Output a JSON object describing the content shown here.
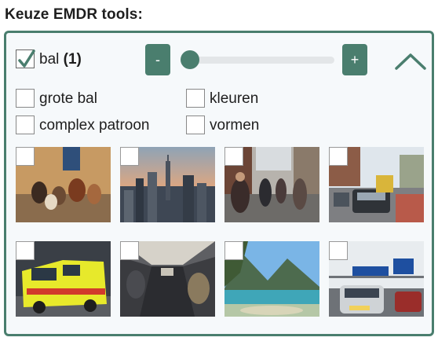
{
  "header": {
    "title": "Keuze EMDR tools:"
  },
  "main_tool": {
    "name": "bal",
    "count": "(1)",
    "checked": true
  },
  "speed": {
    "minus_label": "-",
    "plus_label": "+",
    "level": 0.0
  },
  "options": [
    {
      "label": "grote bal",
      "checked": false
    },
    {
      "label": "kleuren",
      "checked": false
    },
    {
      "label": "complex patroon",
      "checked": false
    },
    {
      "label": "vormen",
      "checked": false
    }
  ],
  "images": [
    {
      "name": "dogs-on-leash-image"
    },
    {
      "name": "city-skyline-sunset-image"
    },
    {
      "name": "cyclists-street-image"
    },
    {
      "name": "traffic-jam-city-image"
    },
    {
      "name": "ambulance-image"
    },
    {
      "name": "airplane-aisle-image"
    },
    {
      "name": "mountain-lake-image"
    },
    {
      "name": "highway-traffic-image"
    }
  ],
  "colors": {
    "accent": "#4a7e6e",
    "panel_bg": "#f6f9fb",
    "track": "#e3e6e8"
  }
}
